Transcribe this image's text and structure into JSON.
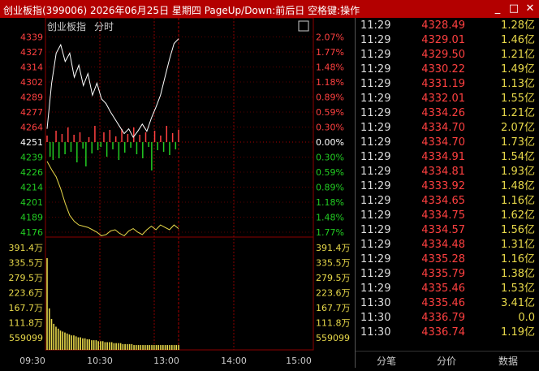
{
  "window": {
    "title": "创业板指(399006) 2026年06月25日 星期四 PageUp/Down:前后日 空格键:操作",
    "min_glyph": "_",
    "restore_glyph": "□",
    "close_glyph": "✕"
  },
  "chart": {
    "name": "创业板指",
    "mode": "分时",
    "collapse_glyph": "□"
  },
  "colors": {
    "up": "#ff4040",
    "down": "#22cc22",
    "price_line": "#ffffff",
    "avg_line": "#e8d94a",
    "volume": "#e8d94a",
    "grid": "#8b0000"
  },
  "chart_data": {
    "type": "line",
    "base": "4251",
    "price_ticks_up": [
      "4339",
      "4327",
      "4314",
      "4302",
      "4289",
      "4277",
      "4264"
    ],
    "price_ticks_down": [
      "4239",
      "4226",
      "4214",
      "4201",
      "4189",
      "4176"
    ],
    "pct_ticks_up": [
      "2.07%",
      "1.77%",
      "1.48%",
      "1.18%",
      "0.89%",
      "0.59%",
      "0.30%"
    ],
    "pct_base": "0.00%",
    "pct_ticks_down": [
      "0.30%",
      "0.59%",
      "0.89%",
      "1.18%",
      "1.48%",
      "1.77%"
    ],
    "volume_ticks": [
      "391.4万",
      "335.5万",
      "279.5万",
      "223.6万",
      "167.7万",
      "111.8万",
      "559099"
    ],
    "time_labels": [
      "09:30",
      "10:30",
      "13:00",
      "14:00",
      "15:00"
    ],
    "price_series": [
      4262,
      4300,
      4325,
      4332,
      4318,
      4325,
      4305,
      4315,
      4298,
      4308,
      4290,
      4300,
      4287,
      4283,
      4276,
      4270,
      4264,
      4258,
      4262,
      4255,
      4260,
      4266,
      4260,
      4271,
      4280,
      4290,
      4305,
      4320,
      4333,
      4337
    ],
    "avg_series": [
      4235,
      4228,
      4222,
      4212,
      4200,
      4190,
      4185,
      4182,
      4181,
      4180,
      4178,
      4176,
      4173,
      4174,
      4177,
      4178,
      4175,
      4173,
      4177,
      4179,
      4176,
      4174,
      4178,
      4181,
      4178,
      4182,
      4180,
      4178,
      4182,
      4179
    ],
    "volume_fraction_series": [
      0.95,
      0.43,
      0.32,
      0.27,
      0.24,
      0.22,
      0.2,
      0.19,
      0.18,
      0.17,
      0.16,
      0.15,
      0.15,
      0.14,
      0.13,
      0.13,
      0.12,
      0.12,
      0.11,
      0.11,
      0.1,
      0.1,
      0.1,
      0.09,
      0.09,
      0.09,
      0.08,
      0.08,
      0.08,
      0.08,
      0.07,
      0.07,
      0.07,
      0.07,
      0.06,
      0.06,
      0.06,
      0.06,
      0.06,
      0.05,
      0.05,
      0.05,
      0.05,
      0.05,
      0.05,
      0.05,
      0.05,
      0.05,
      0.05,
      0.05,
      0.05,
      0.05,
      0.05,
      0.05,
      0.05,
      0.05,
      0.05,
      0.05,
      0.05,
      0.05
    ],
    "breadth_series": [
      8,
      -18,
      -22,
      14,
      -20,
      10,
      -15,
      18,
      -12,
      9,
      -25,
      12,
      -8,
      -30,
      6,
      -14,
      20,
      -10,
      -6,
      12,
      -18,
      15,
      -9,
      7,
      -22,
      16,
      -13,
      10,
      -7,
      18,
      -15,
      9,
      -20,
      12,
      -6,
      -35,
      14,
      -10,
      8,
      -12,
      20,
      -16,
      11,
      -9,
      15
    ]
  },
  "ticks": [
    {
      "time": "11:29",
      "price": "4328.49",
      "vol": "1.28亿"
    },
    {
      "time": "11:29",
      "price": "4329.01",
      "vol": "1.46亿"
    },
    {
      "time": "11:29",
      "price": "4329.50",
      "vol": "1.21亿"
    },
    {
      "time": "11:29",
      "price": "4330.22",
      "vol": "1.49亿"
    },
    {
      "time": "11:29",
      "price": "4331.19",
      "vol": "1.13亿"
    },
    {
      "time": "11:29",
      "price": "4332.01",
      "vol": "1.55亿"
    },
    {
      "time": "11:29",
      "price": "4334.26",
      "vol": "1.21亿"
    },
    {
      "time": "11:29",
      "price": "4334.70",
      "vol": "2.07亿"
    },
    {
      "time": "11:29",
      "price": "4334.70",
      "vol": "1.73亿"
    },
    {
      "time": "11:29",
      "price": "4334.91",
      "vol": "1.54亿"
    },
    {
      "time": "11:29",
      "price": "4334.81",
      "vol": "1.93亿"
    },
    {
      "time": "11:29",
      "price": "4333.92",
      "vol": "1.48亿"
    },
    {
      "time": "11:29",
      "price": "4334.65",
      "vol": "1.16亿"
    },
    {
      "time": "11:29",
      "price": "4334.75",
      "vol": "1.62亿"
    },
    {
      "time": "11:29",
      "price": "4334.57",
      "vol": "1.56亿"
    },
    {
      "time": "11:29",
      "price": "4334.48",
      "vol": "1.31亿"
    },
    {
      "time": "11:29",
      "price": "4335.28",
      "vol": "1.16亿"
    },
    {
      "time": "11:29",
      "price": "4335.79",
      "vol": "1.38亿"
    },
    {
      "time": "11:29",
      "price": "4335.46",
      "vol": "1.53亿"
    },
    {
      "time": "11:30",
      "price": "4335.46",
      "vol": "3.41亿"
    },
    {
      "time": "11:30",
      "price": "4336.79",
      "vol": "0.0"
    },
    {
      "time": "11:30",
      "price": "4336.74",
      "vol": "1.19亿"
    }
  ],
  "tabs": [
    "分笔",
    "分价",
    "数据"
  ]
}
